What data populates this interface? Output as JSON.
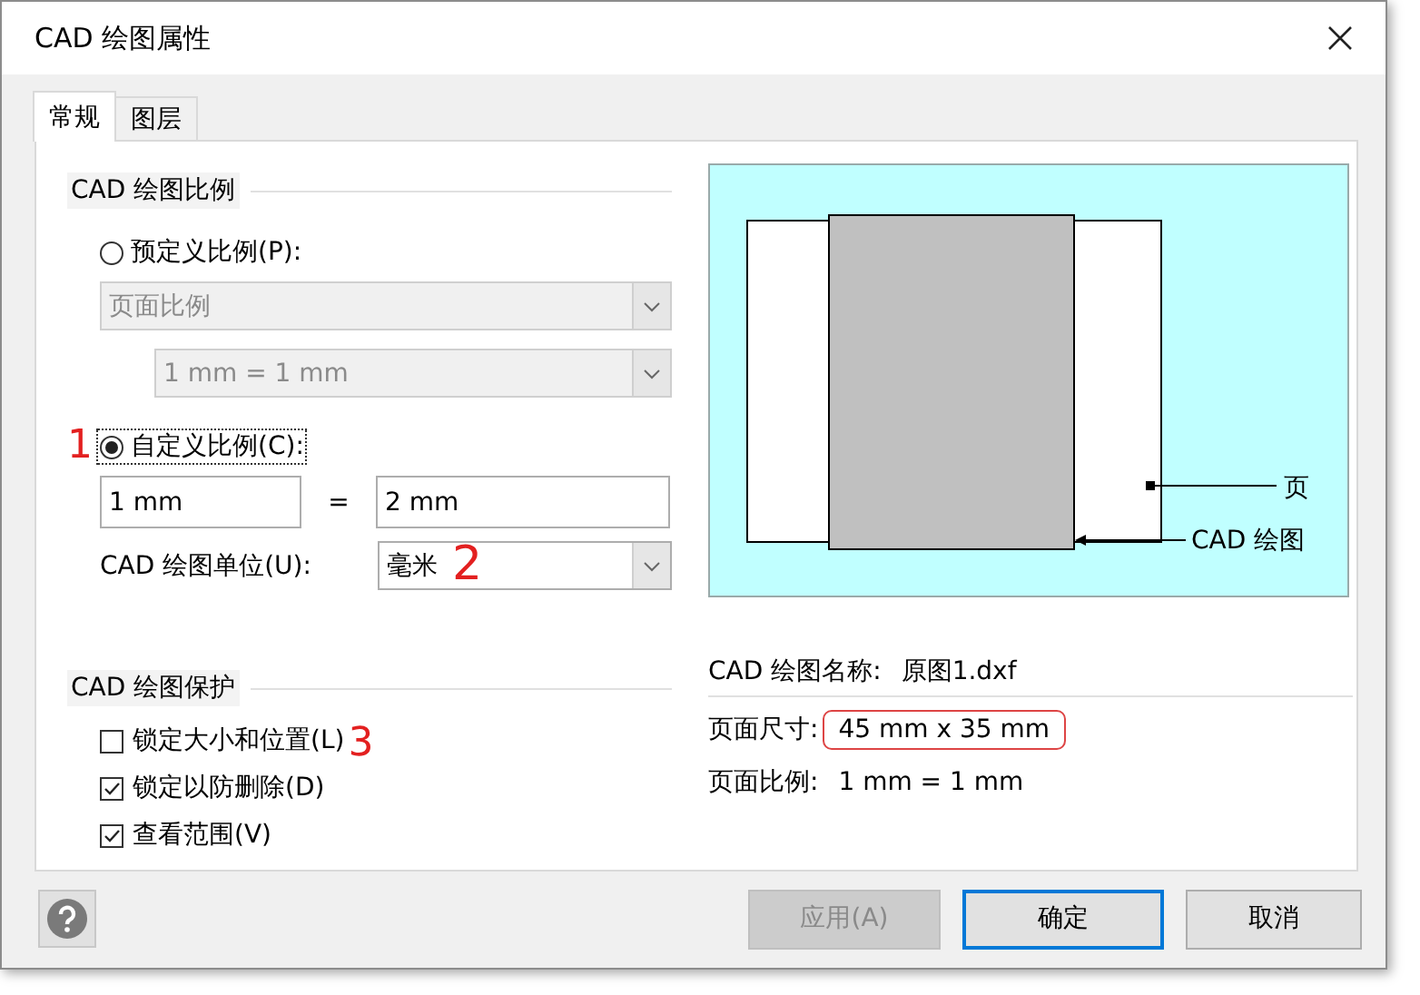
{
  "window": {
    "title": "CAD 绘图属性"
  },
  "tabs": [
    {
      "label": "常规",
      "selected": true
    },
    {
      "label": "图层",
      "selected": false
    }
  ],
  "scale": {
    "heading": "CAD 绘图比例",
    "options": [
      {
        "kind": "preset",
        "label": "预定义比例(P):",
        "selected": false,
        "focused": false
      },
      {
        "kind": "custom",
        "label": "自定义比例(C):",
        "selected": true,
        "focused": true,
        "annotation": "1"
      }
    ],
    "preset_type": {
      "value": "页面比例",
      "disabled": true
    },
    "preset_ratio": {
      "value": "1 mm = 1 mm",
      "disabled": true
    },
    "page_value": "1 mm",
    "equals": "=",
    "drawing_value": "2 mm",
    "unit": {
      "label": "CAD 绘图单位(U):",
      "value": "毫米",
      "annotation": "2"
    }
  },
  "protection": {
    "heading": "CAD 绘图保护",
    "checkboxes": [
      {
        "label": "锁定大小和位置(L)",
        "checked": false,
        "annotation": "3"
      },
      {
        "label": "锁定以防删除(D)",
        "checked": true
      },
      {
        "label": "查看范围(V)",
        "checked": true
      }
    ]
  },
  "preview": {
    "page_label": "页",
    "drawing_label": "CAD 绘图"
  },
  "info": [
    {
      "label": "CAD 绘图名称:",
      "value": "原图1.dxf",
      "highlighted": false
    },
    {
      "label": "页面尺寸:",
      "value": "45 mm x 35 mm",
      "highlighted": true
    },
    {
      "label": "页面比例:",
      "value": "1 mm = 1 mm",
      "highlighted": false
    }
  ],
  "buttons": [
    {
      "label": "应用(A)",
      "disabled": true,
      "default": false
    },
    {
      "label": "确定",
      "disabled": false,
      "default": true
    },
    {
      "label": "取消",
      "disabled": false,
      "default": false
    }
  ]
}
